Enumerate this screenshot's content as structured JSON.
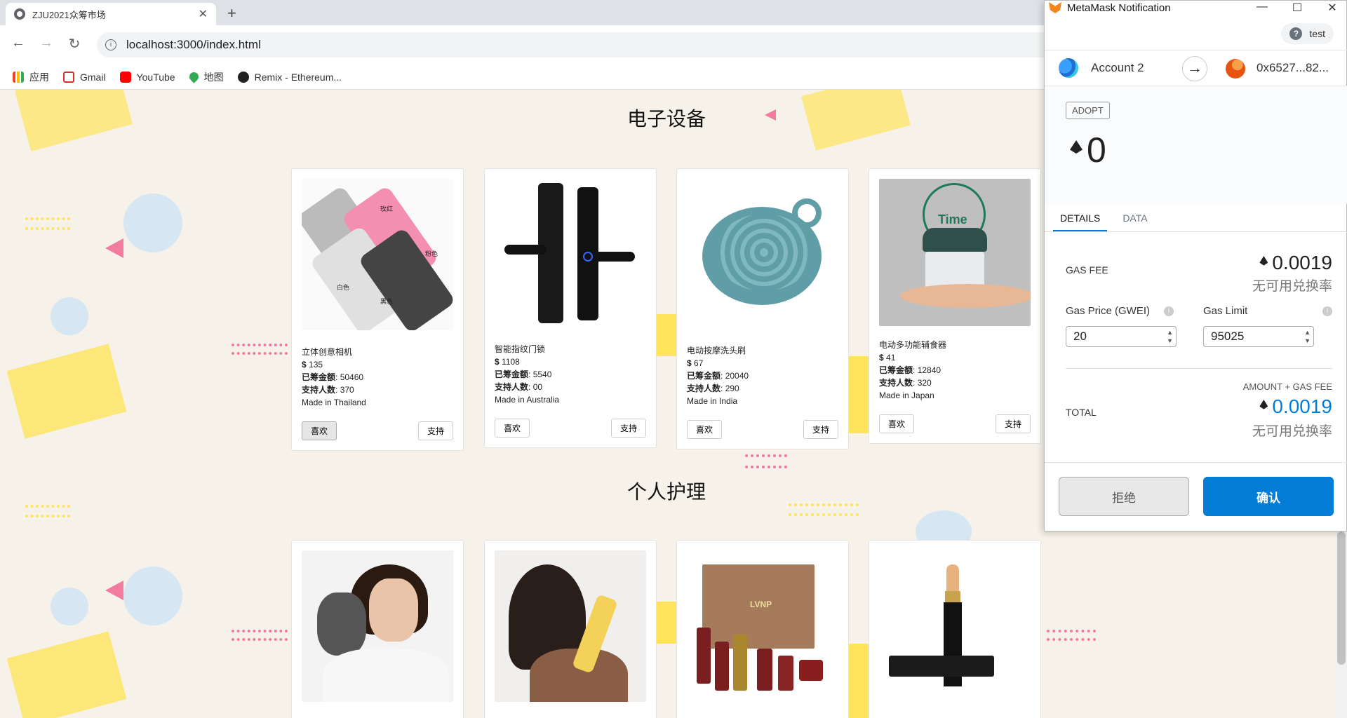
{
  "browser": {
    "tab_title": "ZJU2021众筹市场",
    "tab_close": "✕",
    "new_tab": "+",
    "url": "localhost:3000/index.html",
    "back": "←",
    "forward": "→",
    "reload": "↻",
    "bookmarks": [
      {
        "label": "应用",
        "color": "#ea4335"
      },
      {
        "label": "Gmail",
        "color": "#d93025"
      },
      {
        "label": "YouTube",
        "color": "#ff0000"
      },
      {
        "label": "地图",
        "color": "#34a853"
      },
      {
        "label": "Remix - Ethereum...",
        "color": "#222222"
      }
    ]
  },
  "page": {
    "sections": [
      {
        "title": "电子设备"
      },
      {
        "title": "个人护理"
      }
    ],
    "labels": {
      "raised": "已筹金额",
      "backers": "支持人数",
      "like": "喜欢",
      "support": "支持",
      "currency": "$"
    },
    "electronics": [
      {
        "name": "立体创意相机",
        "price": "135",
        "raised": "50460",
        "backers": "370",
        "origin": "Made in Thailand"
      },
      {
        "name": "智能指纹门锁",
        "price": "1108",
        "raised": "5540",
        "backers": "00",
        "origin": "Made in Australia"
      },
      {
        "name": "电动按摩洗头刷",
        "price": "67",
        "raised": "20040",
        "backers": "290",
        "origin": "Made in India"
      },
      {
        "name": "电动多功能辅食器",
        "price": "41",
        "raised": "12840",
        "backers": "320",
        "origin": "Made in Japan"
      }
    ],
    "camera_labels": [
      "玫红",
      "粉色",
      "白色",
      "黑色"
    ],
    "product_clock_text": "Time",
    "personal_care_box_text": "LVNP"
  },
  "metamask": {
    "window_title": "MetaMask Notification",
    "win_min": "—",
    "win_max": "☐",
    "win_close": "✕",
    "network": "test",
    "network_icon": "?",
    "from_account": "Account 2",
    "to_address": "0x6527...82...",
    "arrow": "→",
    "method_badge": "ADOPT",
    "amount": "0",
    "tabs": [
      "DETAILS",
      "DATA"
    ],
    "gas_fee_label": "GAS FEE",
    "gas_fee_value": "0.0019",
    "no_rate": "无可用兑换率",
    "gas_price_label": "Gas Price (GWEI)",
    "gas_price_value": "20",
    "gas_limit_label": "Gas Limit",
    "gas_limit_value": "95025",
    "amount_plus_gas_label": "AMOUNT + GAS FEE",
    "total_label": "TOTAL",
    "total_value": "0.0019",
    "total_no_rate": "无可用兑换率",
    "reject": "拒绝",
    "confirm": "确认",
    "accent": "#037dd6"
  }
}
